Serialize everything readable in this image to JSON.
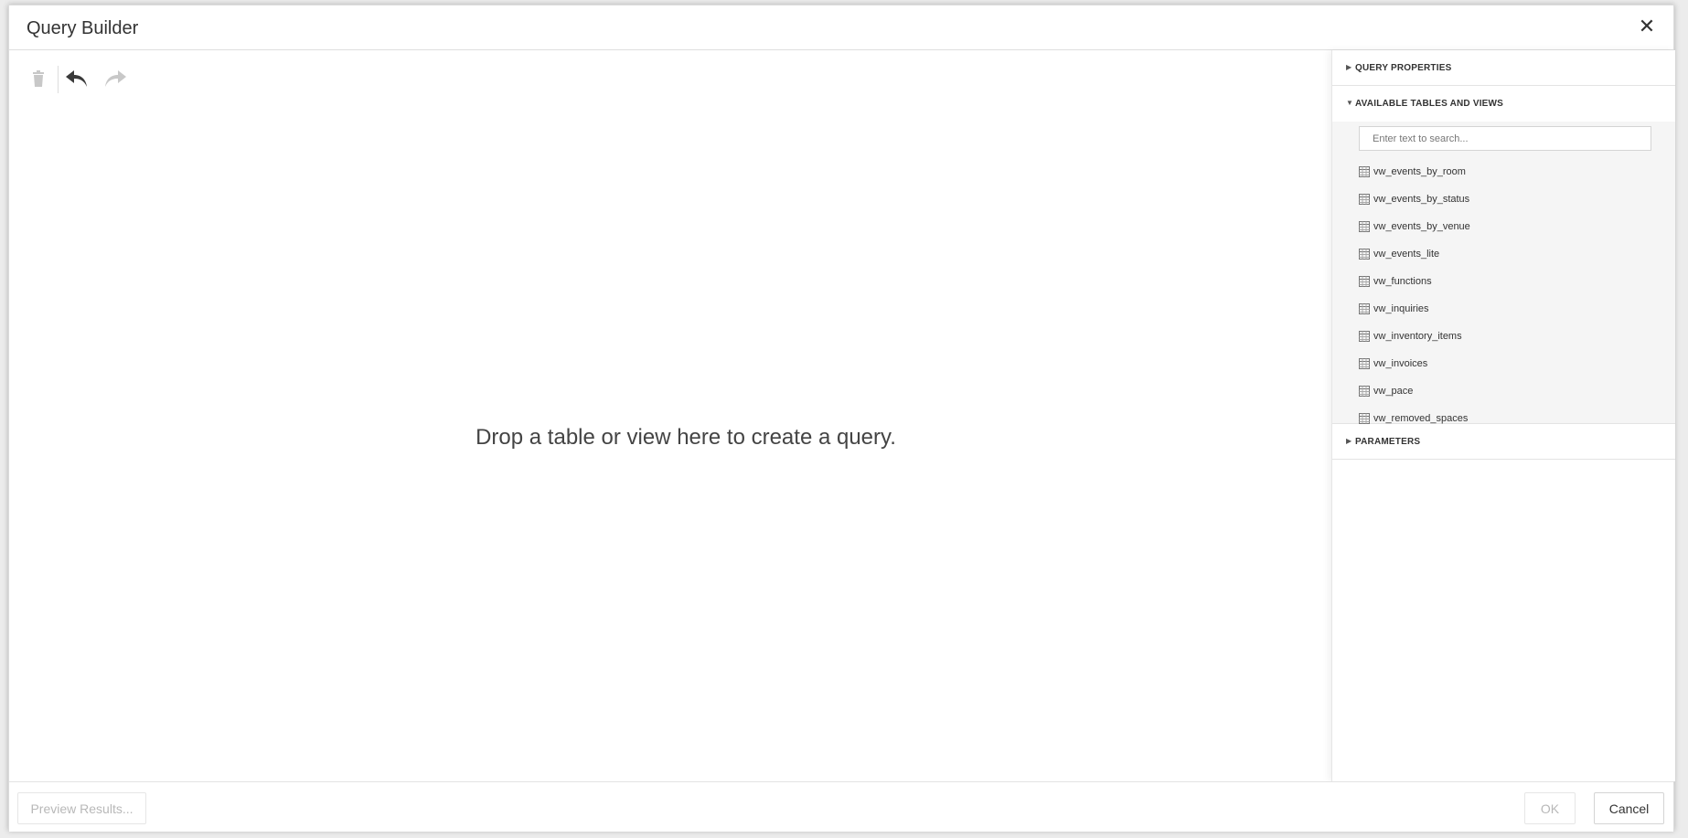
{
  "dialog": {
    "title": "Query Builder",
    "close_label": "✕"
  },
  "toolbar": {
    "delete_icon": "trash-icon",
    "undo_icon": "undo-icon",
    "redo_icon": "redo-icon"
  },
  "canvas": {
    "drop_hint": "Drop a table or view here to create a query."
  },
  "side_panel": {
    "sections": {
      "query_properties": "QUERY PROPERTIES",
      "available_tables": "AVAILABLE TABLES AND VIEWS",
      "parameters": "PARAMETERS"
    },
    "search_placeholder": "Enter text to search...",
    "tables": [
      "vw_events_by_room",
      "vw_events_by_status",
      "vw_events_by_venue",
      "vw_events_lite",
      "vw_functions",
      "vw_inquiries",
      "vw_inventory_items",
      "vw_invoices",
      "vw_pace",
      "vw_removed_spaces"
    ]
  },
  "footer": {
    "preview_label": "Preview Results...",
    "ok_label": "OK",
    "cancel_label": "Cancel"
  },
  "colors": {
    "border": "#dedede",
    "disabled_text": "#b8b8b8",
    "panel_bg": "#f5f5f5"
  }
}
